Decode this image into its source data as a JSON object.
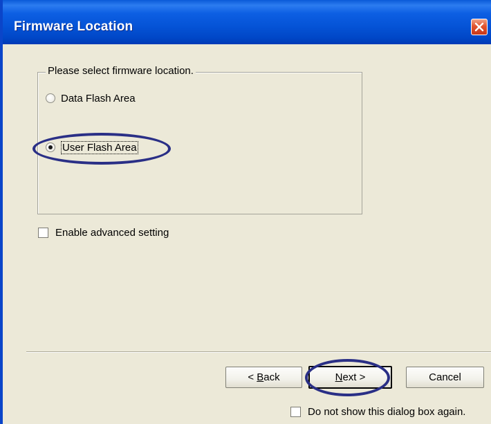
{
  "window": {
    "title": "Firmware Location"
  },
  "location_group": {
    "legend": "Please select firmware location.",
    "options": [
      {
        "label": "Data Flash Area",
        "selected": false
      },
      {
        "label": "User Flash Area",
        "selected": true
      }
    ]
  },
  "advanced": {
    "label": "Enable advanced setting",
    "checked": false
  },
  "buttons": {
    "back_prefix": "< ",
    "back_hotkey": "B",
    "back_rest": "ack",
    "next_hotkey": "N",
    "next_rest": "ext >",
    "cancel": "Cancel"
  },
  "footer": {
    "dont_show_label": "Do not show this dialog box again.",
    "dont_show_checked": false
  },
  "colors": {
    "titlebar": "#0553d6",
    "dialog_bg": "#ece9d8",
    "highlight_ring": "#2a2f86"
  }
}
